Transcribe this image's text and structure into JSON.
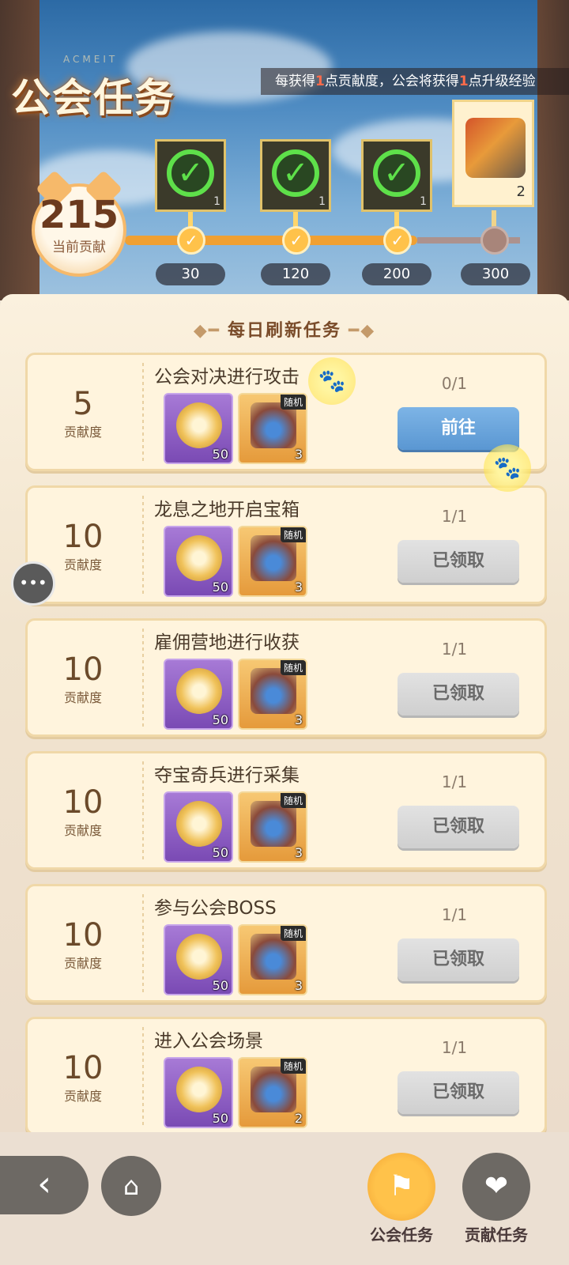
{
  "header": {
    "title": "公会任务",
    "title_watermark": "ACMEIT",
    "notice": {
      "p1": "每获得",
      "n1": "1",
      "p2": "点贡献度，公会将获得",
      "n2": "1",
      "p3": "点升级经验"
    },
    "current_score": "215",
    "current_score_label": "当前贡献"
  },
  "milestones": [
    {
      "threshold": "30",
      "reward_count": "1",
      "claimed": true,
      "icon": "check-icon"
    },
    {
      "threshold": "120",
      "reward_count": "1",
      "claimed": true,
      "icon": "check-icon"
    },
    {
      "threshold": "200",
      "reward_count": "1",
      "claimed": true,
      "icon": "check-icon"
    },
    {
      "threshold": "300",
      "reward_count": "2",
      "claimed": false,
      "icon": "scroll-icon"
    }
  ],
  "progress_fraction": 0.72,
  "section_title": "每日刷新任务",
  "tasks": [
    {
      "points": "5",
      "unit": "贡献度",
      "name": "公会对决进行攻击",
      "progress": "0/1",
      "medal_qty": "50",
      "chest_qty": "3",
      "chest_tag": "随机",
      "button": "前往",
      "state": "go"
    },
    {
      "points": "10",
      "unit": "贡献度",
      "name": "龙息之地开启宝箱",
      "progress": "1/1",
      "medal_qty": "50",
      "chest_qty": "3",
      "chest_tag": "随机",
      "button": "已领取",
      "state": "done"
    },
    {
      "points": "10",
      "unit": "贡献度",
      "name": "雇佣营地进行收获",
      "progress": "1/1",
      "medal_qty": "50",
      "chest_qty": "3",
      "chest_tag": "随机",
      "button": "已领取",
      "state": "done"
    },
    {
      "points": "10",
      "unit": "贡献度",
      "name": "夺宝奇兵进行采集",
      "progress": "1/1",
      "medal_qty": "50",
      "chest_qty": "3",
      "chest_tag": "随机",
      "button": "已领取",
      "state": "done"
    },
    {
      "points": "10",
      "unit": "贡献度",
      "name": "参与公会BOSS",
      "progress": "1/1",
      "medal_qty": "50",
      "chest_qty": "3",
      "chest_tag": "随机",
      "button": "已领取",
      "state": "done"
    },
    {
      "points": "10",
      "unit": "贡献度",
      "name": "进入公会场景",
      "progress": "1/1",
      "medal_qty": "50",
      "chest_qty": "2",
      "chest_tag": "随机",
      "button": "已领取",
      "state": "done"
    }
  ],
  "bottom_nav": {
    "guild_tasks": "公会任务",
    "contribution_tasks": "贡献任务"
  },
  "colors": {
    "accent": "#f0a032",
    "go_button": "#5a97d2",
    "highlight": "#ff6b4a"
  }
}
